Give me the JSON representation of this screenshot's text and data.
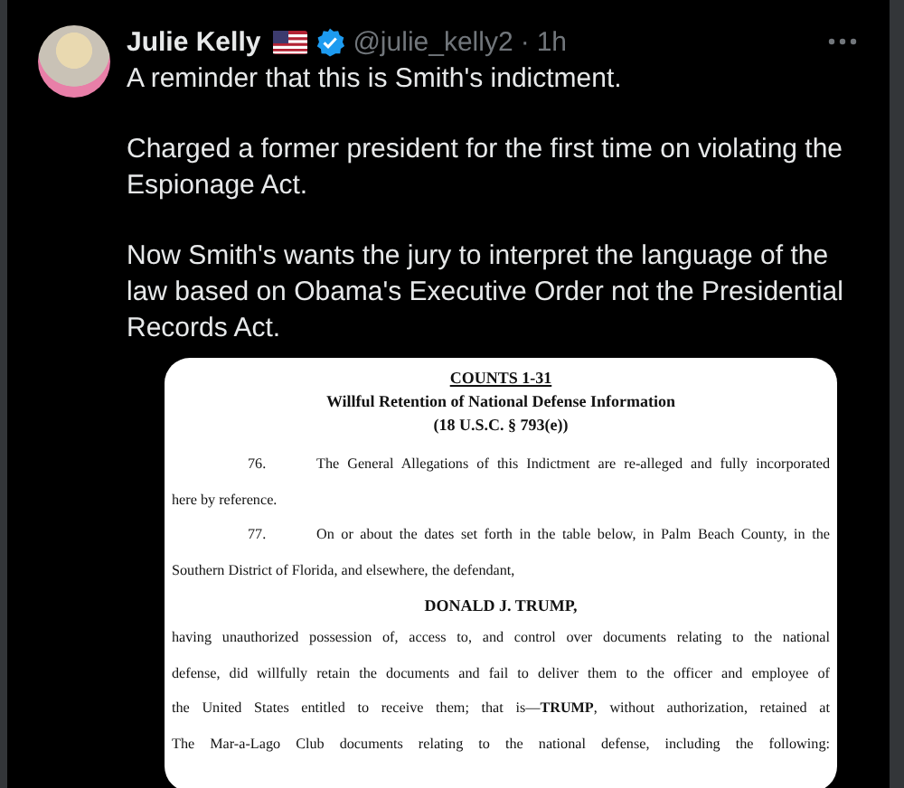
{
  "post": {
    "author": {
      "name": "Julie Kelly",
      "handle": "@julie_kelly2",
      "separator": "·",
      "time": "1h",
      "verified": true
    },
    "paragraphs": [
      "A reminder that this is Smith's indictment.",
      "Charged a former president for the first time on violating the Espionage Act.",
      "Now Smith's wants the jury to interpret the language of the law based on Obama's Executive Order not the Presidential Records Act."
    ],
    "attachment": {
      "kind": "document",
      "lines": [
        {
          "kind": "title",
          "text": "COUNTS 1-31"
        },
        {
          "kind": "heading",
          "text": "Willful Retention of National Defense Information"
        },
        {
          "kind": "heading",
          "text": "(18 U.S.C. § 793(e))"
        },
        {
          "kind": "numbered",
          "number": "76.",
          "text": "The General Allegations of this Indictment are re-alleged and fully incorporated"
        },
        {
          "kind": "last",
          "text": "here by reference."
        },
        {
          "kind": "numbered",
          "number": "77.",
          "text": "On or about the dates set forth in the table below, in Palm Beach County, in the"
        },
        {
          "kind": "last",
          "text": "Southern District of Florida, and elsewhere, the defendant,"
        },
        {
          "kind": "heading",
          "text": "DONALD J. TRUMP,"
        },
        {
          "kind": "body",
          "text": "having unauthorized possession of, access to, and control over documents relating to the national"
        },
        {
          "kind": "body",
          "text": "defense, did willfully retain the documents and fail to deliver them to the officer and employee of"
        },
        {
          "kind": "body",
          "text": "the United States entitled to receive them; that is—**TRUMP**, without authorization, retained at"
        },
        {
          "kind": "body",
          "text": "The Mar-a-Lago Club documents relating to the national defense, including the following:"
        }
      ]
    }
  }
}
